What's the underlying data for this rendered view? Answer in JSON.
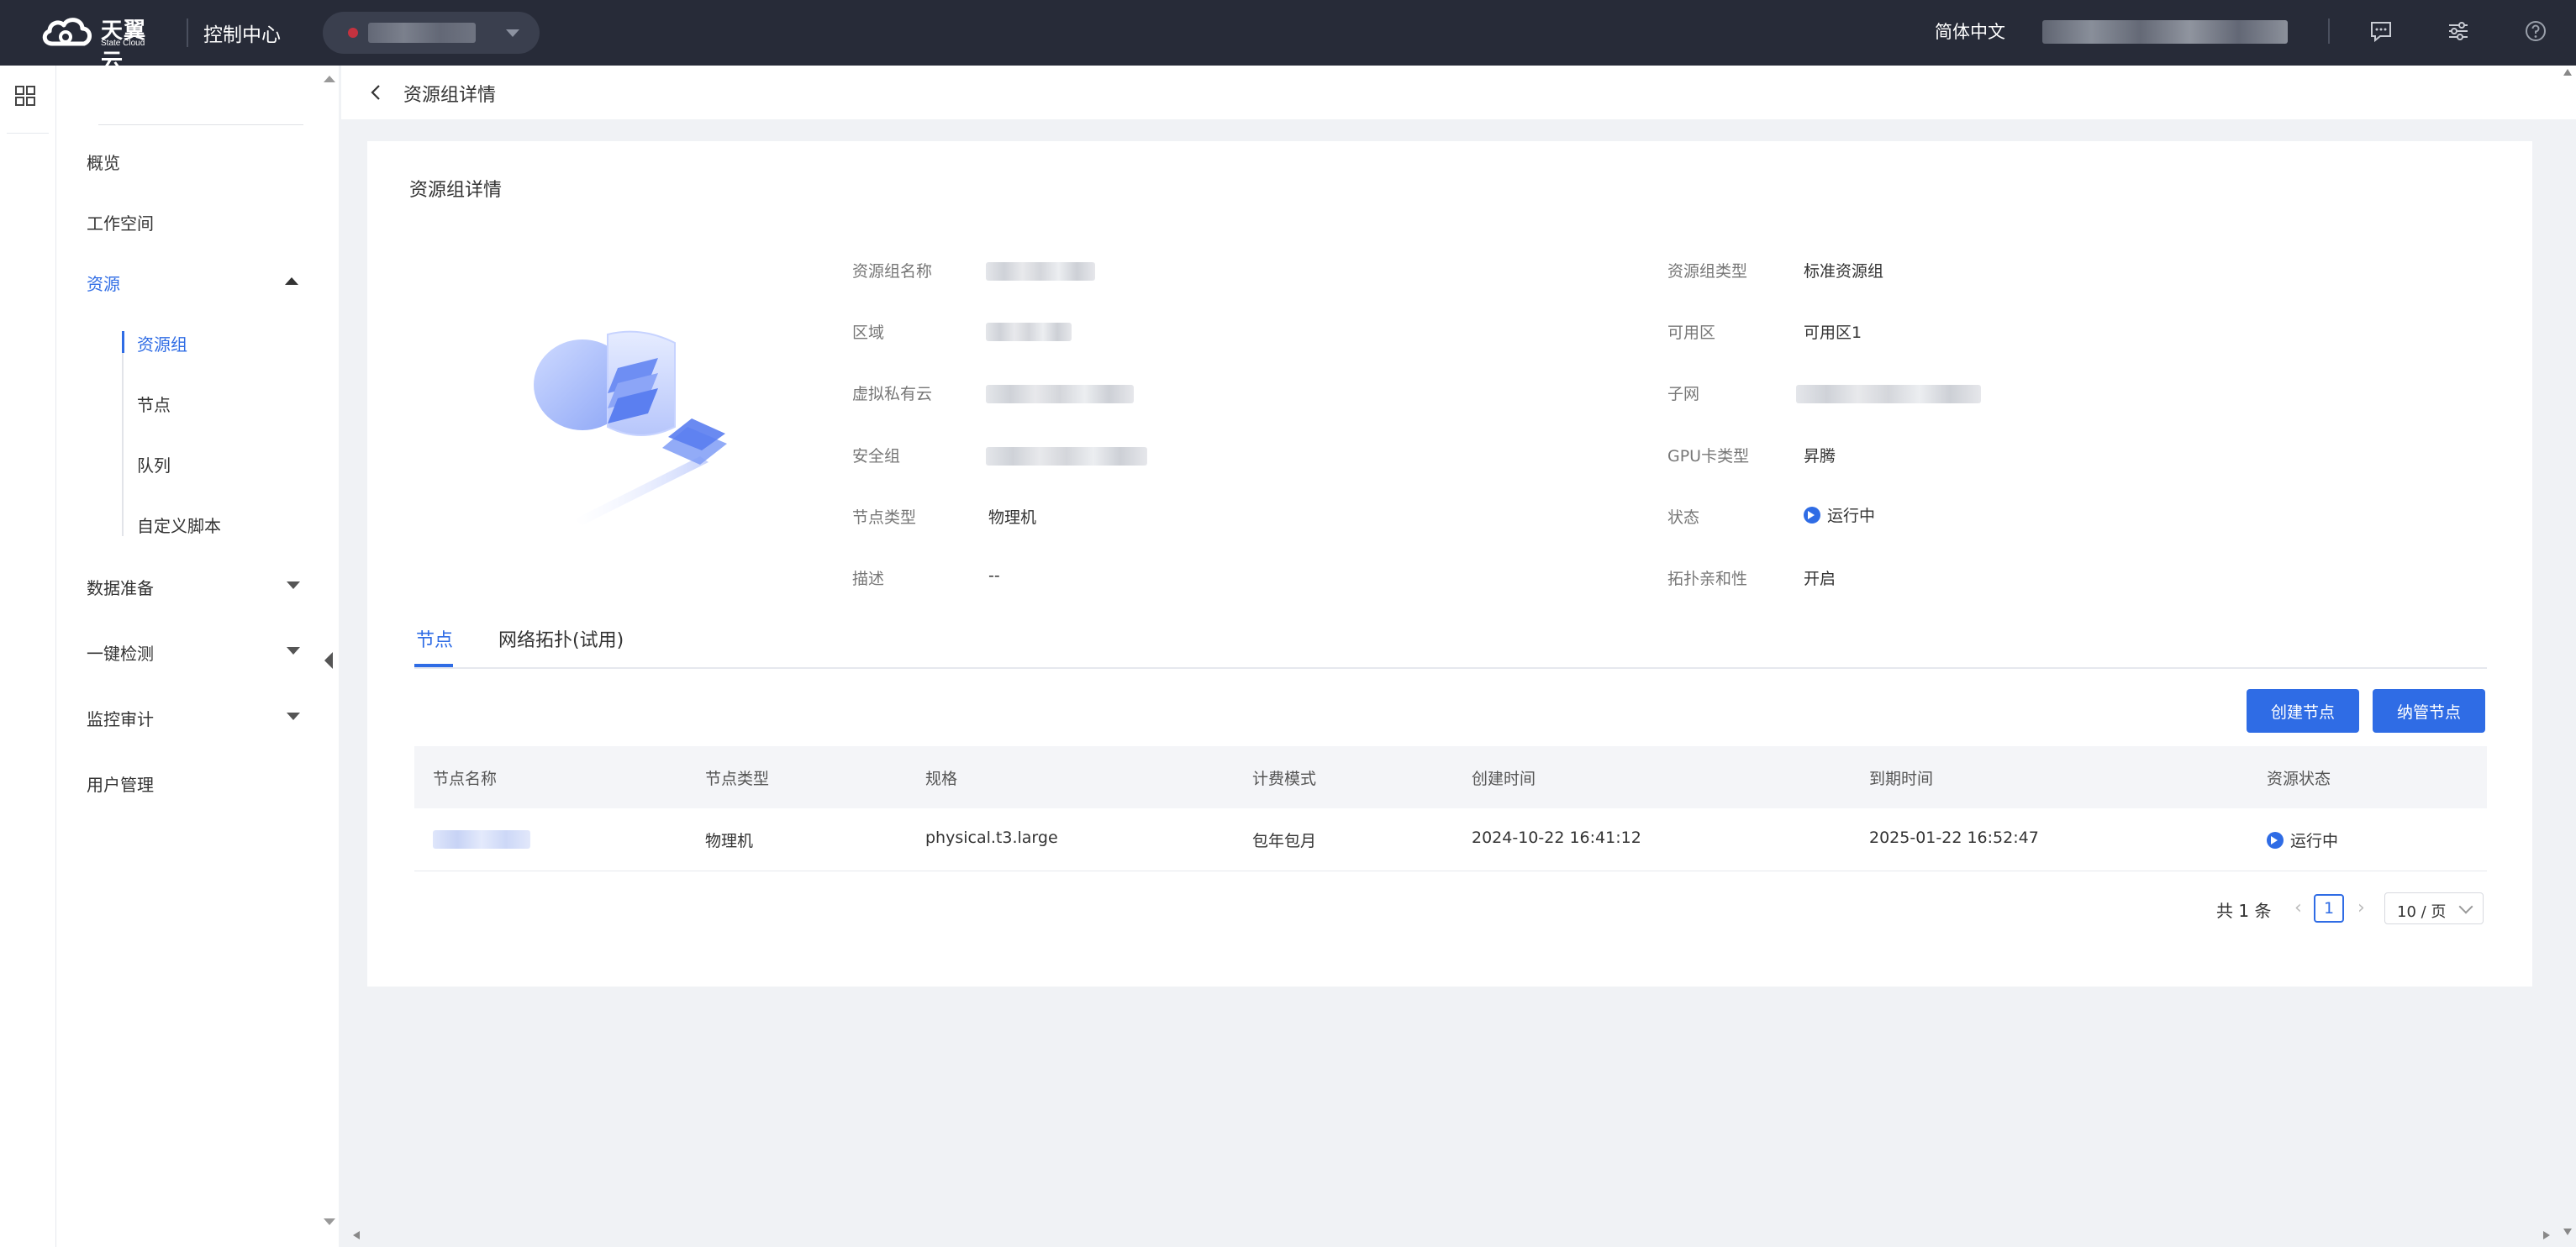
{
  "brand": {
    "name_cn": "天翼云",
    "name_en": "State Cloud"
  },
  "topbar": {
    "console": "控制中心",
    "language": "简体中文"
  },
  "sidebar": {
    "items": [
      {
        "label": "概览"
      },
      {
        "label": "工作空间"
      },
      {
        "label": "资源"
      },
      {
        "label": "数据准备"
      },
      {
        "label": "一键检测"
      },
      {
        "label": "监控审计"
      },
      {
        "label": "用户管理"
      }
    ],
    "resource_sub": [
      {
        "label": "资源组"
      },
      {
        "label": "节点"
      },
      {
        "label": "队列"
      },
      {
        "label": "自定义脚本"
      }
    ]
  },
  "header": {
    "title": "资源组详情"
  },
  "card": {
    "title": "资源组详情"
  },
  "details": {
    "name_label": "资源组名称",
    "type_label": "资源组类型",
    "type_value": "标准资源组",
    "region_label": "区域",
    "az_label": "可用区",
    "az_value": "可用区1",
    "vpc_label": "虚拟私有云",
    "subnet_label": "子网",
    "sg_label": "安全组",
    "gpu_label": "GPU卡类型",
    "gpu_value": "昇腾",
    "node_type_label": "节点类型",
    "node_type_value": "物理机",
    "status_label": "状态",
    "status_value": "运行中",
    "desc_label": "描述",
    "desc_value": "--",
    "topo_label": "拓扑亲和性",
    "topo_value": "开启"
  },
  "tabs": [
    {
      "label": "节点"
    },
    {
      "label": "网络拓扑(试用)"
    }
  ],
  "actions": {
    "create": "创建节点",
    "manage": "纳管节点"
  },
  "table": {
    "headers": [
      "节点名称",
      "节点类型",
      "规格",
      "计费模式",
      "创建时间",
      "到期时间",
      "资源状态"
    ],
    "rows": [
      {
        "type": "物理机",
        "spec": "physical.t3.large",
        "billing": "包年包月",
        "created": "2024-10-22 16:41:12",
        "expires": "2025-01-22 16:52:47",
        "status": "运行中"
      }
    ]
  },
  "pagination": {
    "total": "共 1 条",
    "current_page": "1",
    "page_size": "10 / 页"
  },
  "colors": {
    "accent": "#2f6ce5",
    "topbar": "#272b38"
  }
}
